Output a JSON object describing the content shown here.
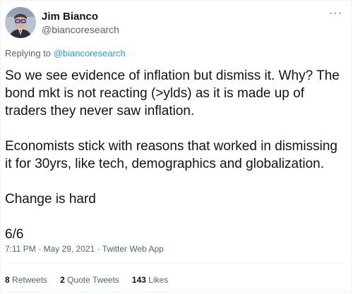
{
  "author": {
    "name": "Jim Bianco",
    "handle": "@biancoresearch"
  },
  "replying": {
    "prefix": "Replying to",
    "handle": "@biancoresearch"
  },
  "more_label": "···",
  "tweet_lines": [
    "So we see evidence of inflation but dismiss it. Why? The",
    "bond mkt is not reacting (>ylds) as it is made up of",
    "traders they never saw inflation.",
    "Economists stick with reasons that worked in dismissing",
    "it for 30yrs, like tech, demographics and globalization.",
    "Change is hard",
    "6/6"
  ],
  "meta": {
    "time": "7:11 PM",
    "date": "May 29, 2021",
    "source": "Twitter Web App",
    "separator": "·"
  },
  "stats": {
    "retweets_count": "8",
    "retweets_label": "Retweets",
    "quotes_count": "2",
    "quotes_label": "Quote Tweets",
    "likes_count": "143",
    "likes_label": "Likes"
  }
}
